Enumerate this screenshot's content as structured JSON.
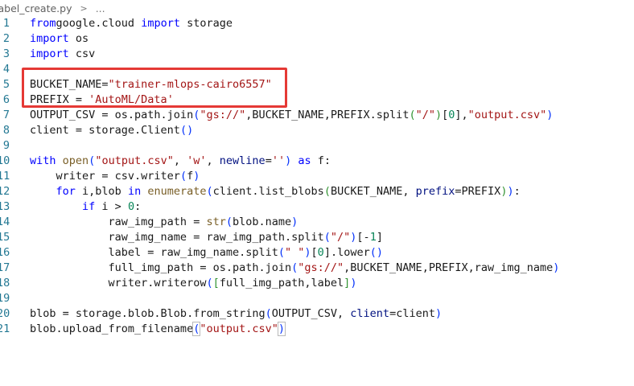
{
  "breadcrumb": {
    "file": "label_create.py",
    "separator": ">",
    "more": "..."
  },
  "editor": {
    "lines": [
      {
        "n": "1",
        "tokens": [
          [
            "kw",
            "from"
          ],
          [
            "",
            "google.cloud "
          ],
          [
            "kw",
            "import"
          ],
          [
            "",
            " storage"
          ]
        ]
      },
      {
        "n": "2",
        "tokens": [
          [
            "kw",
            "import"
          ],
          [
            "",
            " os"
          ]
        ]
      },
      {
        "n": "3",
        "tokens": [
          [
            "kw",
            "import"
          ],
          [
            "",
            " csv"
          ]
        ]
      },
      {
        "n": "4",
        "tokens": []
      },
      {
        "n": "5",
        "tokens": [
          [
            "",
            "BUCKET_NAME="
          ],
          [
            "str",
            "\"trainer-mlops-cairo6557\""
          ]
        ]
      },
      {
        "n": "6",
        "tokens": [
          [
            "",
            "PREFIX = "
          ],
          [
            "str",
            "'AutoML/Data'"
          ]
        ]
      },
      {
        "n": "7",
        "tokens": [
          [
            "",
            "OUTPUT_CSV = os.path.join"
          ],
          [
            "br1",
            "("
          ],
          [
            "str",
            "\"gs://\""
          ],
          [
            "",
            ",BUCKET_NAME,PREFIX.split"
          ],
          [
            "br2",
            "("
          ],
          [
            "str",
            "\"/\""
          ],
          [
            "br2",
            ")"
          ],
          [
            "",
            "["
          ],
          [
            "num",
            "0"
          ],
          [
            "",
            "],"
          ],
          [
            "str",
            "\"output.csv\""
          ],
          [
            "br1",
            ")"
          ]
        ]
      },
      {
        "n": "8",
        "tokens": [
          [
            "",
            "client = storage.Client"
          ],
          [
            "br1",
            "()"
          ]
        ]
      },
      {
        "n": "9",
        "tokens": []
      },
      {
        "n": "10",
        "tokens": [
          [
            "kw",
            "with"
          ],
          [
            "",
            " "
          ],
          [
            "fn",
            "open"
          ],
          [
            "br1",
            "("
          ],
          [
            "str",
            "\"output.csv\""
          ],
          [
            "",
            ", "
          ],
          [
            "str",
            "'w'"
          ],
          [
            "",
            ", "
          ],
          [
            "param",
            "newline"
          ],
          [
            "",
            "="
          ],
          [
            "str",
            "''"
          ],
          [
            "br1",
            ")"
          ],
          [
            "",
            " "
          ],
          [
            "kw",
            "as"
          ],
          [
            "",
            " f:"
          ]
        ]
      },
      {
        "n": "11",
        "tokens": [
          [
            "",
            "    writer = csv.writer"
          ],
          [
            "br1",
            "("
          ],
          [
            "",
            "f"
          ],
          [
            "br1",
            ")"
          ]
        ]
      },
      {
        "n": "12",
        "tokens": [
          [
            "",
            "    "
          ],
          [
            "kw",
            "for"
          ],
          [
            "",
            " i,blob "
          ],
          [
            "kw",
            "in"
          ],
          [
            "",
            " "
          ],
          [
            "fn",
            "enumerate"
          ],
          [
            "br1",
            "("
          ],
          [
            "",
            "client.list_blobs"
          ],
          [
            "br2",
            "("
          ],
          [
            "",
            "BUCKET_NAME, "
          ],
          [
            "param",
            "prefix"
          ],
          [
            "",
            "=PREFIX"
          ],
          [
            "br2",
            ")"
          ],
          [
            "br1",
            ")"
          ],
          [
            "",
            ":"
          ]
        ]
      },
      {
        "n": "13",
        "tokens": [
          [
            "",
            "        "
          ],
          [
            "kw",
            "if"
          ],
          [
            "",
            " i > "
          ],
          [
            "num",
            "0"
          ],
          [
            "",
            ":"
          ]
        ]
      },
      {
        "n": "14",
        "tokens": [
          [
            "",
            "            raw_img_path = "
          ],
          [
            "fn",
            "str"
          ],
          [
            "br1",
            "("
          ],
          [
            "",
            "blob.name"
          ],
          [
            "br1",
            ")"
          ]
        ]
      },
      {
        "n": "15",
        "tokens": [
          [
            "",
            "            raw_img_name = raw_img_path.split"
          ],
          [
            "br1",
            "("
          ],
          [
            "str",
            "\"/\""
          ],
          [
            "br1",
            ")"
          ],
          [
            "",
            "[-"
          ],
          [
            "num",
            "1"
          ],
          [
            "",
            "]"
          ]
        ]
      },
      {
        "n": "16",
        "tokens": [
          [
            "",
            "            label = raw_img_name.split"
          ],
          [
            "br1",
            "("
          ],
          [
            "str",
            "\" \""
          ],
          [
            "br1",
            ")"
          ],
          [
            "",
            "["
          ],
          [
            "num",
            "0"
          ],
          [
            "",
            "].lower"
          ],
          [
            "br1",
            "()"
          ]
        ]
      },
      {
        "n": "17",
        "tokens": [
          [
            "",
            "            full_img_path = os.path.join"
          ],
          [
            "br1",
            "("
          ],
          [
            "str",
            "\"gs://\""
          ],
          [
            "",
            ",BUCKET_NAME,PREFIX,raw_img_name"
          ],
          [
            "br1",
            ")"
          ]
        ]
      },
      {
        "n": "18",
        "tokens": [
          [
            "",
            "            writer.writerow"
          ],
          [
            "br1",
            "("
          ],
          [
            "br2",
            "["
          ],
          [
            "",
            "full_img_path,label"
          ],
          [
            "br2",
            "]"
          ],
          [
            "br1",
            ")"
          ]
        ]
      },
      {
        "n": "19",
        "tokens": []
      },
      {
        "n": "20",
        "tokens": [
          [
            "",
            "blob = storage.blob.Blob.from_string"
          ],
          [
            "br1",
            "("
          ],
          [
            "",
            "OUTPUT_CSV, "
          ],
          [
            "param",
            "client"
          ],
          [
            "",
            "=client"
          ],
          [
            "br1",
            ")"
          ]
        ]
      },
      {
        "n": "21",
        "tokens": [
          [
            "",
            "blob.upload_from_filename"
          ],
          [
            "br1m",
            "("
          ],
          [
            "str",
            "\"output.csv\""
          ],
          [
            "br1m",
            ")"
          ],
          [
            "cursor",
            ""
          ]
        ]
      }
    ]
  },
  "annotation": {
    "color": "#e53935"
  }
}
